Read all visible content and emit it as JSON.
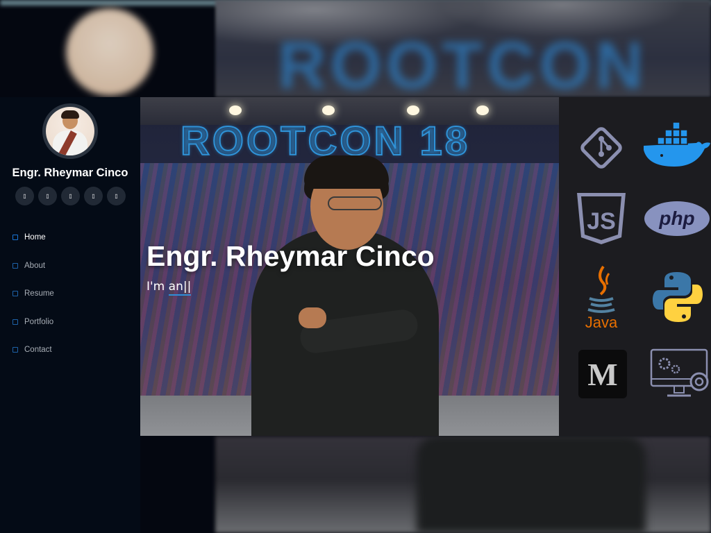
{
  "sidebar": {
    "name": "Engr. Rheymar Cinco",
    "socials": [
      {
        "icon": "twitter-icon",
        "glyph": "▯"
      },
      {
        "icon": "facebook-icon",
        "glyph": "▯"
      },
      {
        "icon": "instagram-icon",
        "glyph": "▯"
      },
      {
        "icon": "skype-icon",
        "glyph": "▯"
      },
      {
        "icon": "linkedin-icon",
        "glyph": "▯"
      }
    ],
    "nav": [
      {
        "label": "Home",
        "icon": "house-icon",
        "active": true
      },
      {
        "label": "About",
        "icon": "person-icon",
        "active": false
      },
      {
        "label": "Resume",
        "icon": "file-icon",
        "active": false
      },
      {
        "label": "Portfolio",
        "icon": "book-icon",
        "active": false
      },
      {
        "label": "Contact",
        "icon": "envelope-icon",
        "active": false
      }
    ]
  },
  "hero": {
    "title": "Engr. Rheymar Cinco",
    "typed_prefix": "I'm ",
    "typed_text": "an",
    "cursor": "||",
    "backdrop_sign": "ROOTCON 18"
  },
  "tech_stack": [
    {
      "name": "git-icon"
    },
    {
      "name": "docker-icon"
    },
    {
      "name": "javascript-icon",
      "text": "JS"
    },
    {
      "name": "php-icon",
      "text": "php"
    },
    {
      "name": "java-icon",
      "text": "Java"
    },
    {
      "name": "python-icon"
    },
    {
      "name": "medium-icon",
      "text": "M"
    },
    {
      "name": "settings-monitor-icon"
    }
  ],
  "colors": {
    "sidebar_bg": "#040b16",
    "accent": "#1975d6",
    "tech_bg": "#1c1c20"
  }
}
